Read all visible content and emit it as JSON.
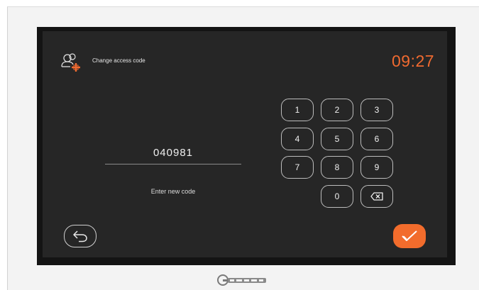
{
  "header": {
    "icon": "user-plus-icon",
    "title": "Change access code",
    "clock": "09:27"
  },
  "code_entry": {
    "value": "040981",
    "hint": "Enter new code"
  },
  "keypad": {
    "keys": [
      "1",
      "2",
      "3",
      "4",
      "5",
      "6",
      "7",
      "8",
      "9",
      "0"
    ],
    "delete_icon": "backspace-icon"
  },
  "footer": {
    "back_icon": "back-arrow-icon",
    "confirm_icon": "checkmark-icon",
    "brand_logo": "golmar-logo"
  },
  "colors": {
    "accent": "#f06a30",
    "screen": "#262626",
    "bezel": "#141414"
  }
}
